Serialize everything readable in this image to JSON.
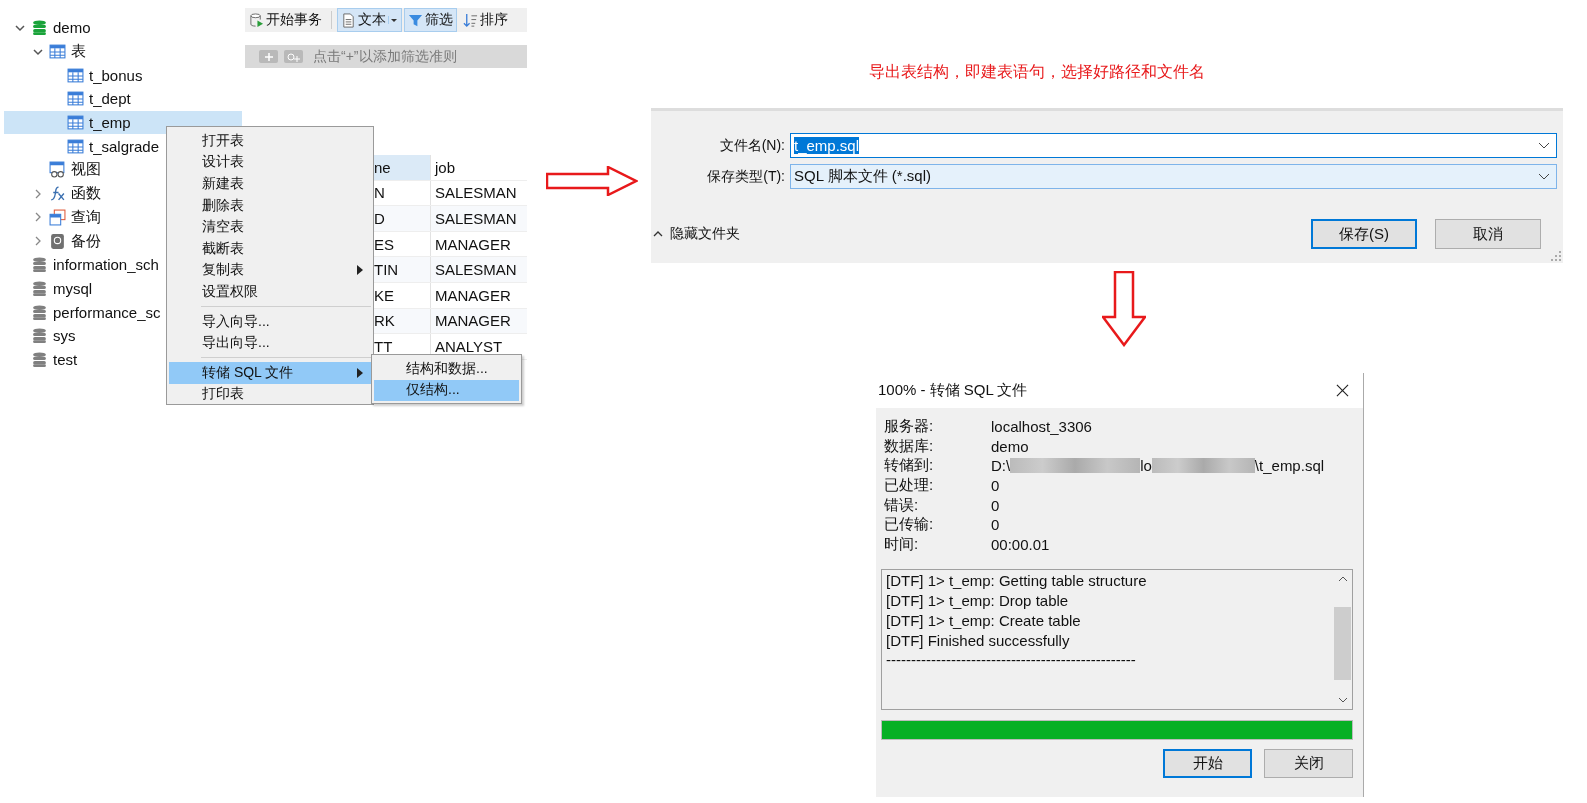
{
  "navigator": {
    "items": [
      {
        "label": "demo",
        "kind": "database",
        "color": "#1aa33a",
        "selected": false,
        "expanded": true,
        "children": [
          {
            "label": "表",
            "kind": "tables",
            "selected": false,
            "expanded": true,
            "children": [
              {
                "label": "t_bonus",
                "kind": "table",
                "selected": false
              },
              {
                "label": "t_dept",
                "kind": "table",
                "selected": false
              },
              {
                "label": "t_emp",
                "kind": "table",
                "selected": true
              },
              {
                "label": "t_salgrade",
                "kind": "table",
                "selected": false
              }
            ]
          },
          {
            "label": "视图",
            "kind": "views",
            "selected": false
          },
          {
            "label": "函数",
            "kind": "functions",
            "selected": false,
            "expanded": false
          },
          {
            "label": "查询",
            "kind": "queries",
            "selected": false,
            "expanded": false
          },
          {
            "label": "备份",
            "kind": "backups",
            "selected": false,
            "expanded": false
          }
        ]
      },
      {
        "label": "information_sch",
        "kind": "database",
        "color": "#808080",
        "selected": false
      },
      {
        "label": "mysql",
        "kind": "database",
        "color": "#808080",
        "selected": false
      },
      {
        "label": "performance_sc",
        "kind": "database",
        "color": "#808080",
        "selected": false
      },
      {
        "label": "sys",
        "kind": "database",
        "color": "#808080",
        "selected": false
      },
      {
        "label": "test",
        "kind": "database",
        "color": "#808080",
        "selected": false
      }
    ]
  },
  "toolbar": [
    {
      "label": "开始事务",
      "kind": "transaction",
      "selected": false
    },
    {
      "label": "文本",
      "kind": "text",
      "selected": true
    },
    {
      "label": "筛选",
      "kind": "filter",
      "selected": true
    },
    {
      "label": "排序",
      "kind": "sort",
      "selected": false
    }
  ],
  "filter_bar": {
    "placeholder": "点击“+”以添加筛选准则"
  },
  "grid": {
    "columns": [
      "ne",
      "job"
    ],
    "rows": [
      [
        "N",
        "SALESMAN"
      ],
      [
        "D",
        "SALESMAN"
      ],
      [
        "ES",
        "MANAGER"
      ],
      [
        "TIN",
        "SALESMAN"
      ],
      [
        "KE",
        "MANAGER"
      ],
      [
        "RK",
        "MANAGER"
      ],
      [
        "TT",
        "ANALYST"
      ]
    ]
  },
  "context_menu": {
    "groups": [
      [
        {
          "label": "打开表",
          "submenu": false,
          "selected": false
        },
        {
          "label": "设计表",
          "submenu": false,
          "selected": false
        },
        {
          "label": "新建表",
          "submenu": false,
          "selected": false
        },
        {
          "label": "删除表",
          "submenu": false,
          "selected": false
        },
        {
          "label": "清空表",
          "submenu": false,
          "selected": false
        },
        {
          "label": "截断表",
          "submenu": false,
          "selected": false
        },
        {
          "label": "复制表",
          "submenu": true,
          "selected": false
        },
        {
          "label": "设置权限",
          "submenu": false,
          "selected": false
        }
      ],
      [
        {
          "label": "导入向导...",
          "submenu": false,
          "selected": false
        },
        {
          "label": "导出向导...",
          "submenu": false,
          "selected": false
        }
      ],
      [
        {
          "label": "转储 SQL 文件",
          "submenu": true,
          "selected": true
        },
        {
          "label": "打印表",
          "submenu": false,
          "selected": false
        }
      ]
    ],
    "submenu": [
      {
        "label": "结构和数据...",
        "selected": false
      },
      {
        "label": "仅结构...",
        "selected": true
      }
    ]
  },
  "annotation": "导出表结构，即建表语句，选择好路径和文件名",
  "save_dialog": {
    "fields": [
      {
        "label": "文件名(N):",
        "value": "t_emp.sql",
        "text_selected": true
      },
      {
        "label": "保存类型(T):",
        "value": "SQL 脚本文件 (*.sql)",
        "text_selected": false
      }
    ],
    "hide_folders": "隐藏文件夹",
    "buttons": [
      {
        "label": "保存(S)",
        "default": true
      },
      {
        "label": "取消",
        "default": false
      }
    ]
  },
  "progress_dialog": {
    "title": "100% - 转储 SQL 文件",
    "info": [
      {
        "label": "服务器:",
        "value": "localhost_3306"
      },
      {
        "label": "数据库:",
        "value": "demo"
      },
      {
        "label": "转储到:",
        "segments": [
          "D:\\",
          "lo",
          "\\t_emp.sql"
        ]
      },
      {
        "label": "已处理:",
        "value": "0"
      },
      {
        "label": "错误:",
        "value": "0"
      },
      {
        "label": "已传输:",
        "value": "0"
      },
      {
        "label": "时间:",
        "value": "00:00.01"
      }
    ],
    "log": [
      "[DTF] 1> t_emp: Getting table structure",
      "[DTF] 1> t_emp: Drop table",
      "[DTF] 1> t_emp: Create table",
      "[DTF] Finished successfully",
      "--------------------------------------------------"
    ],
    "level": 1,
    "buttons": [
      {
        "label": "开始",
        "default": true
      },
      {
        "label": "关闭",
        "default": false
      }
    ]
  }
}
